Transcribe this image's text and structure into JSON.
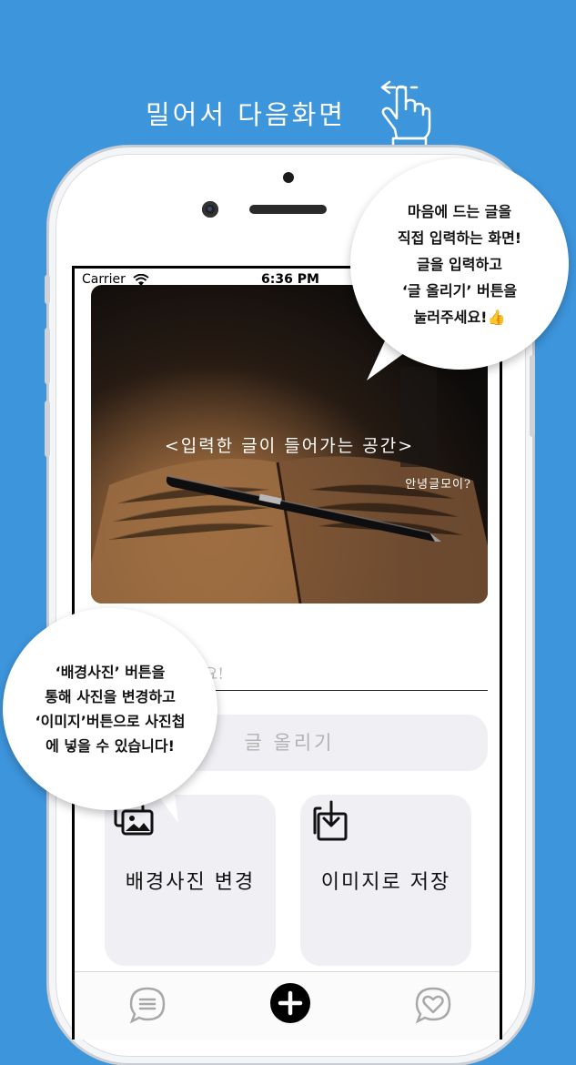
{
  "header": {
    "title": "밀어서 다음화면",
    "icon": "swipe-hand-icon"
  },
  "status_bar": {
    "carrier": "Carrier",
    "time": "6:36 PM"
  },
  "preview": {
    "main_text": "<입력한 글이 들어가는 공간>",
    "sub_text": "안녕글모이?"
  },
  "input": {
    "placeholder": "세요!"
  },
  "post_button": {
    "label": "글 올리기"
  },
  "tiles": [
    {
      "label": "배경사진 변경",
      "icon": "photos-icon"
    },
    {
      "label": "이미지로 저장",
      "icon": "save-download-icon"
    }
  ],
  "tab_bar": {
    "items": [
      {
        "icon": "chat-list-icon"
      },
      {
        "icon": "add-circle-icon"
      },
      {
        "icon": "heart-chat-icon"
      }
    ]
  },
  "callouts": {
    "top": [
      "마음에 드는 글을",
      "직접 입력하는 화면!",
      "글을 입력하고",
      "‘글 올리기’ 버튼을",
      "눌러주세요!👍"
    ],
    "left": [
      "‘배경사진’ 버튼을",
      "통해 사진을 변경하고",
      "‘이미지’버튼으로 사진첩",
      "에 넣을 수 있습니다!"
    ]
  },
  "colors": {
    "background": "#3D95DC",
    "tile": "#EFEFF4",
    "accent_black": "#000000"
  }
}
